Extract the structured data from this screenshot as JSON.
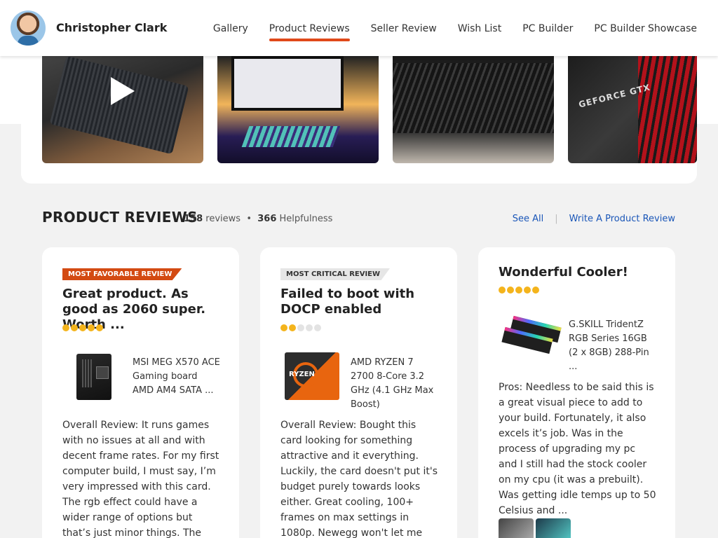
{
  "header": {
    "user_name": "Christopher Clark",
    "nav": [
      "Gallery",
      "Product Reviews",
      "Seller Review",
      "Wish List",
      "PC Builder",
      "PC Builder Showcase"
    ],
    "active_nav": "Product Reviews"
  },
  "gallery": {
    "thumbnail_count": 4,
    "thumb4_text": "GEFORCE GTX"
  },
  "section": {
    "title": "PRODUCT REVIEWS",
    "reviews_count": "158",
    "reviews_label": "reviews",
    "bullet": "•",
    "helpfulness_count": "366",
    "helpfulness_label": "Helpfulness",
    "see_all": "See All",
    "separator": "|",
    "write_review": "Write A Product Review"
  },
  "reviews": [
    {
      "badge": "MOST FAVORABLE REVIEW",
      "title": "Great product. As good as 2060 super. Worth ...",
      "rating": 5,
      "product_name": "MSI MEG X570 ACE Gaming board AMD AM4 SATA ...",
      "body": "Overall Review: It runs games with no issues at all and with decent frame rates. For my first computer build, I must say, I’m very impressed with this card. The rgb effect could have a wider range of options but that’s just minor things. The fans ..."
    },
    {
      "badge": "MOST CRITICAL REVIEW",
      "title": "Failed to boot with DOCP enabled",
      "rating": 2,
      "product_name": "AMD RYZEN 7 2700 8-Core 3.2 GHz (4.1 GHz Max Boost)",
      "product_img_text": "RYZEN",
      "body": "Overall Review: Bought this card looking for something attractive and it everything. Luckily, the card doesn't put it's budget purely towards looks either. Great cooling, 100+ frames on max settings in 1080p. Newegg won't let me change my accidental ..."
    },
    {
      "title": "Wonderful Cooler!",
      "rating": 5,
      "product_name": "G.SKILL TridentZ RGB Series 16GB (2 x 8GB) 288-Pin ...",
      "body": "Pros: Needless to be said this is a great visual piece to add to your build. Fortunately, it also excels it’s job. Was in the process of upgrading my pc and I still had the stock cooler on my cpu (it was a prebuilt). Was getting idle temps up to 50 Celsius and ..."
    }
  ],
  "colors": {
    "accent": "#e0491a",
    "badge_favorable": "#d34a12",
    "star": "#f4b41c",
    "link": "#1a56b8"
  }
}
